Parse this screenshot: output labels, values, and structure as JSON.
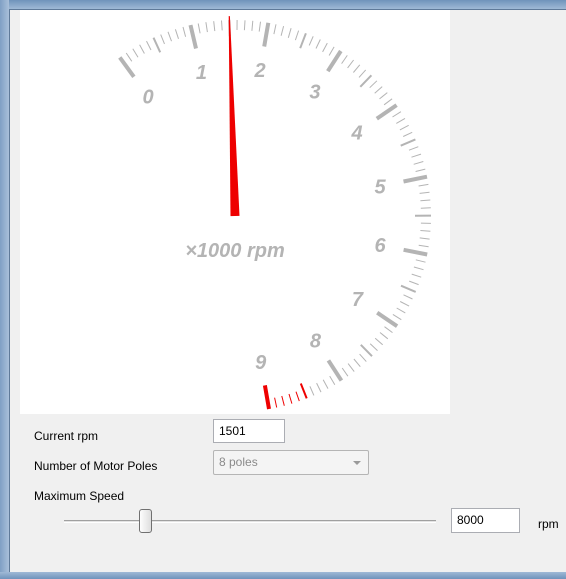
{
  "gauge": {
    "min": 0,
    "max": 9,
    "value": 1.501,
    "tick_labels": [
      "0",
      "1",
      "2",
      "3",
      "4",
      "5",
      "6",
      "7",
      "8",
      "9"
    ],
    "unit_label": "×1000 rpm",
    "redline_from": 8.5,
    "colors": {
      "tick": "#b4b4b4",
      "redline": "#ee0000",
      "needle": "#ee0000",
      "background": "#ffffff"
    }
  },
  "controls": {
    "current_rpm": {
      "label": "Current rpm",
      "value": "1501"
    },
    "motor_poles": {
      "label": "Number of Motor Poles",
      "selected": "8 poles"
    },
    "max_speed": {
      "label": "Maximum Speed",
      "slider_value": 2000,
      "slider_min": 0,
      "slider_max": 10000,
      "field_value": "8000",
      "unit": "rpm"
    }
  }
}
